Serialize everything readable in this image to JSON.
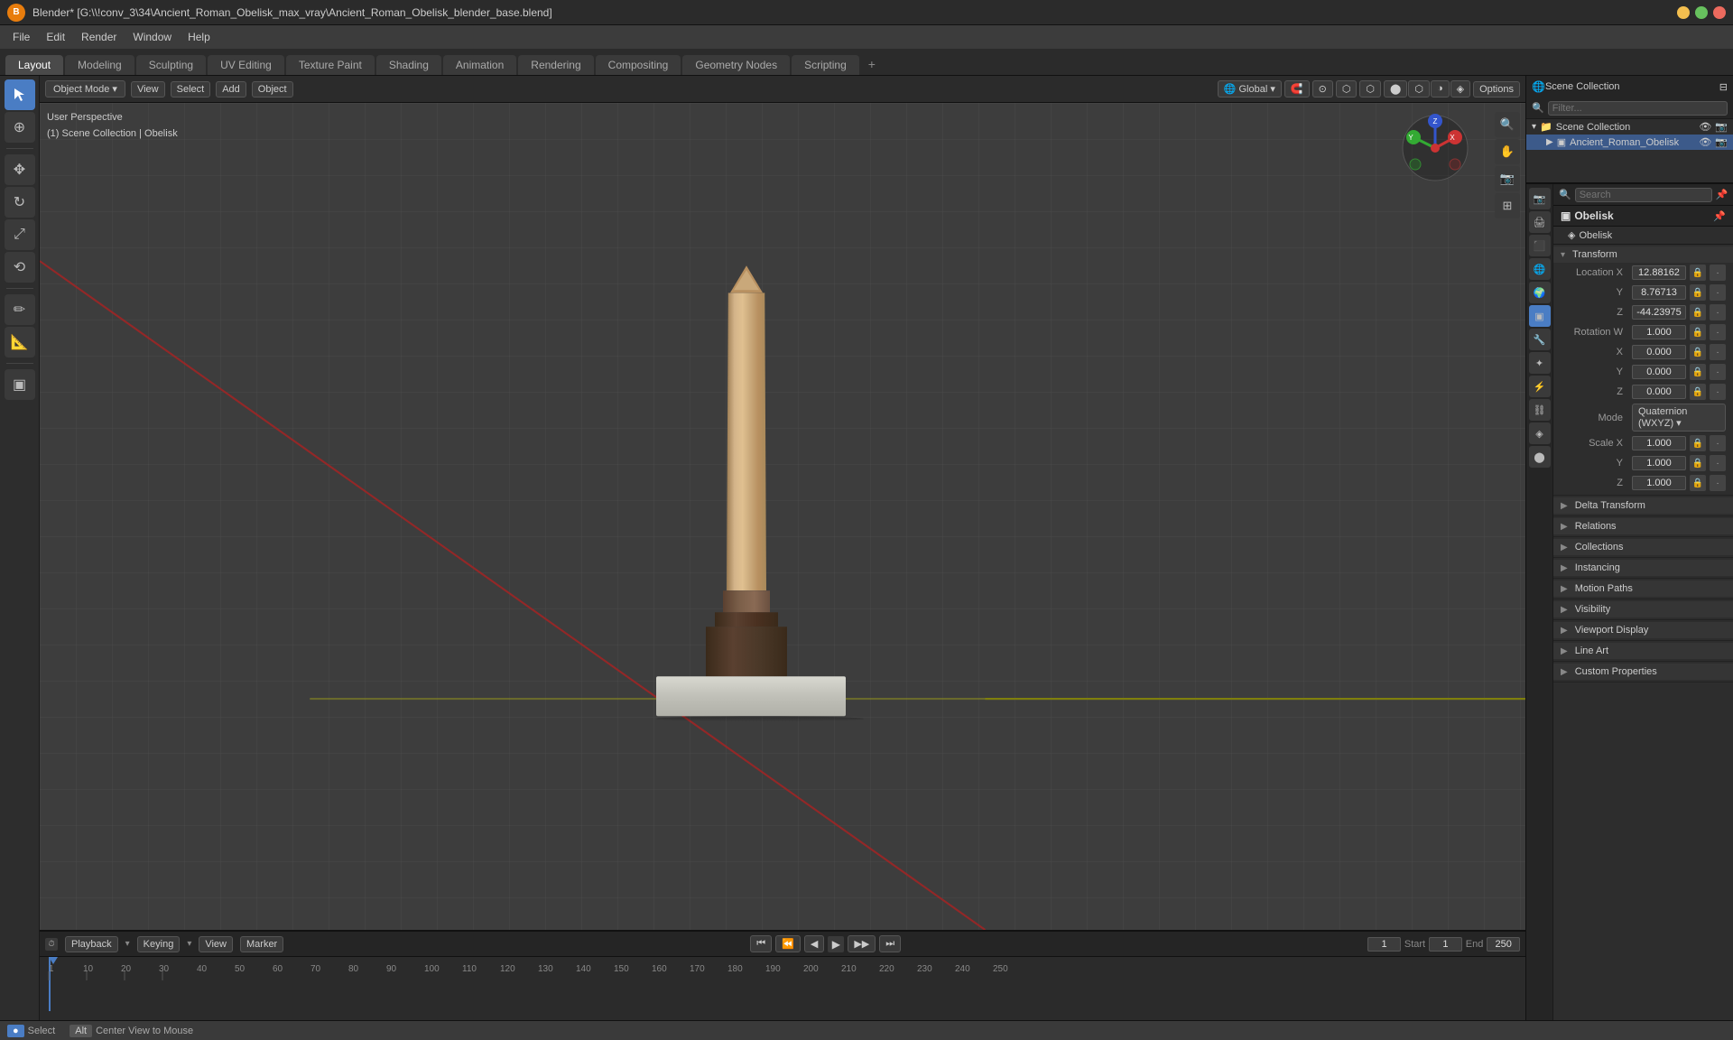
{
  "titlebar": {
    "title": "Blender* [G:\\\\!conv_3\\34\\Ancient_Roman_Obelisk_max_vray\\Ancient_Roman_Obelisk_blender_base.blend]",
    "logo": "B"
  },
  "menu": {
    "items": [
      "File",
      "Edit",
      "Render",
      "Window",
      "Help"
    ]
  },
  "workspaces": {
    "tabs": [
      "Layout",
      "Modeling",
      "Sculpting",
      "UV Editing",
      "Texture Paint",
      "Shading",
      "Animation",
      "Rendering",
      "Compositing",
      "Geometry Nodes",
      "Scripting"
    ],
    "active": "Layout",
    "plus": "+"
  },
  "viewport_header": {
    "mode": "Object Mode",
    "view": "View",
    "select": "Select",
    "add": "Add",
    "object": "Object",
    "global": "Global",
    "options": "Options"
  },
  "viewport_info": {
    "label1": "User Perspective",
    "label2": "(1) Scene Collection | Obelisk"
  },
  "outliner": {
    "title": "Scene Collection",
    "search_placeholder": "Filter...",
    "items": [
      {
        "name": "Scene Collection",
        "icon": "📁",
        "indent": 0
      },
      {
        "name": "Ancient_Roman_Obelisk",
        "icon": "📄",
        "indent": 1,
        "active": true
      }
    ]
  },
  "properties": {
    "object_name": "Obelisk",
    "data_name": "Obelisk",
    "sections": {
      "transform": {
        "label": "Transform",
        "location": {
          "x": "12.88162",
          "y": "8.76713",
          "z": "-44.23975"
        },
        "rotation_w": "1.000",
        "rotation_x": "0.000",
        "rotation_y": "0.000",
        "rotation_z": "0.000",
        "mode": "Quaternion (WXYZ)",
        "scale": {
          "x": "1.000",
          "y": "1.000",
          "z": "1.000"
        }
      },
      "delta_transform": "Delta Transform",
      "relations": "Relations",
      "collections": "Collections",
      "instancing": "Instancing",
      "motion_paths": "Motion Paths",
      "visibility": "Visibility",
      "viewport_display": "Viewport Display",
      "line_art": "Line Art",
      "custom_properties": "Custom Properties"
    }
  },
  "timeline": {
    "playback": "Playback",
    "keying": "Keying",
    "view": "View",
    "marker": "Marker",
    "start": "1",
    "end": "250",
    "frame_start_label": "Start",
    "frame_end_label": "End",
    "current_frame": "1",
    "markers": [
      "1",
      "10",
      "20",
      "30",
      "40",
      "50",
      "60",
      "70",
      "80",
      "90",
      "100",
      "110",
      "120",
      "130",
      "140",
      "150",
      "160",
      "170",
      "180",
      "190",
      "200",
      "210",
      "220",
      "230",
      "240",
      "250"
    ]
  },
  "statusbar": {
    "select": "Select",
    "center": "Center View to Mouse"
  },
  "icons": {
    "transform": "↔",
    "cursor": "⊕",
    "move": "✥",
    "rotate": "↻",
    "scale": "⤢",
    "annotate": "✏",
    "measure": "📐",
    "snap": "🔒",
    "search": "🔍",
    "render": "📷",
    "camera": "🎥",
    "material": "⬤",
    "particle": "✦",
    "physics": "⚡",
    "modifier": "🔧",
    "object": "▣",
    "scene": "🌐",
    "world": "🌍",
    "constraint": "⛓",
    "data": "◈",
    "chevron_right": "▶",
    "chevron_down": "▼",
    "lock": "🔒",
    "dots": "⋮",
    "eye": "👁",
    "filter": "⊟"
  }
}
